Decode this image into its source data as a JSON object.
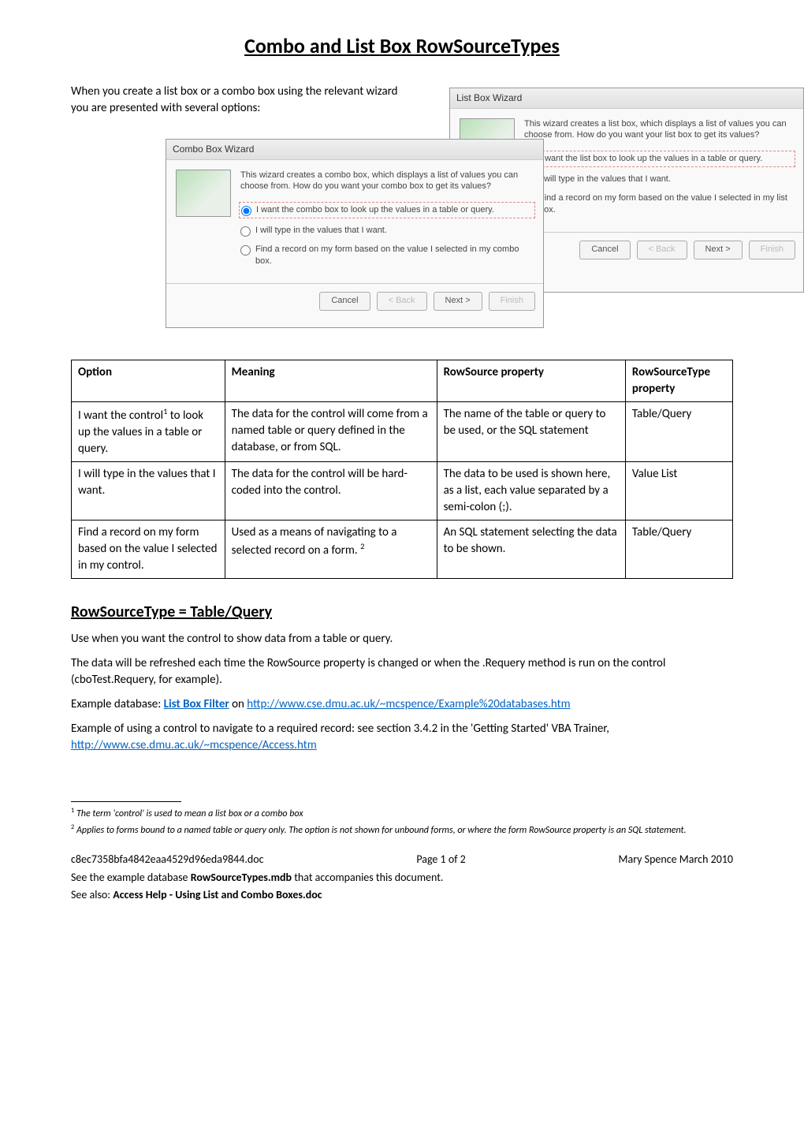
{
  "title": "Combo and List Box RowSourceTypes",
  "intro": "When you create a list box or a combo box using the relevant wizard you are presented with several options:",
  "wizard_list": {
    "title": "List Box Wizard",
    "desc": "This wizard creates a list box, which displays a list of values you can choose from.  How do you want your list box to get its values?",
    "opt1": "I want the list box to look up the values in a table or query.",
    "opt2": "I will type in the values that I want.",
    "opt3": "Find a record on my form based on the value I selected in my list box.",
    "btn_cancel": "Cancel",
    "btn_back": "< Back",
    "btn_next": "Next >",
    "btn_finish": "Finish"
  },
  "wizard_combo": {
    "title": "Combo Box Wizard",
    "desc": "This wizard creates a combo box, which displays a list of values you can choose from.  How do you want your combo box to get its values?",
    "opt1": "I want the combo box to look up the values in a table or query.",
    "opt2": "I will type in the values that I want.",
    "opt3": "Find a record on my form based on the value I selected in my combo box.",
    "btn_cancel": "Cancel",
    "btn_back": "< Back",
    "btn_next": "Next >",
    "btn_finish": "Finish"
  },
  "table": {
    "headers": {
      "option": "Option",
      "meaning": "Meaning",
      "rowsource": "RowSource property",
      "rowsourcetype": "RowSourceType property"
    },
    "rows": [
      {
        "option_pre": "I want the control",
        "option_sup": "1",
        "option_post": " to look up the values in a table or query.",
        "meaning": "The data for the control will come from a named table or query defined in the database, or from SQL.",
        "rowsource": "The name of the table or query to be used, or the SQL statement",
        "rowsourcetype": "Table/Query"
      },
      {
        "option_pre": "I will type in the values that I want.",
        "option_sup": "",
        "option_post": "",
        "meaning": "The data for the control will be hard-coded into the control.",
        "rowsource": "The data to be used is shown here, as a list, each value separated by a semi-colon (;).",
        "rowsourcetype": "Value List"
      },
      {
        "option_pre": "Find a record on my form based on the value I selected in my control.",
        "option_sup": "",
        "option_post": "",
        "meaning_pre": "Used as a means of navigating to a selected record on a form. ",
        "meaning_sup": "2",
        "rowsource": "An SQL statement selecting the data to be shown.",
        "rowsourcetype": "Table/Query"
      }
    ]
  },
  "section": {
    "heading": "RowSourceType = Table/Query",
    "para1": "Use when you want the control to show data from a table or query.",
    "para2": "The data will be refreshed each time the RowSource property is changed or when the .Requery method is run on the control (cboTest.Requery, for example).",
    "example_label": "Example database: ",
    "example_link_text": "List Box Filter",
    "example_on": " on ",
    "example_url": "http://www.cse.dmu.ac.uk/~mcspence/Example%20databases.htm",
    "para4a": "Example of using a control to navigate to a required record: see section 3.4.2 in the 'Getting Started' VBA Trainer, ",
    "para4_url": "http://www.cse.dmu.ac.uk/~mcspence/Access.htm"
  },
  "footnotes": {
    "fn1_sup": "1",
    "fn1": " The term 'control' is used to mean a list box or a combo box",
    "fn2_sup": "2",
    "fn2": " Applies to forms bound to a named table or query only. The option is not shown for unbound forms, or where the form RowSource property is an SQL statement."
  },
  "footer": {
    "filename": "c8ec7358bfa4842eaa4529d96eda9844.doc",
    "page": "Page 1 of 2",
    "author": "Mary Spence March 2010",
    "note1a": "See the example database ",
    "note1b": "RowSourceTypes.mdb",
    "note1c": " that accompanies this document.",
    "note2a": "See also: ",
    "note2b": "Access Help - Using List and Combo Boxes.doc"
  }
}
